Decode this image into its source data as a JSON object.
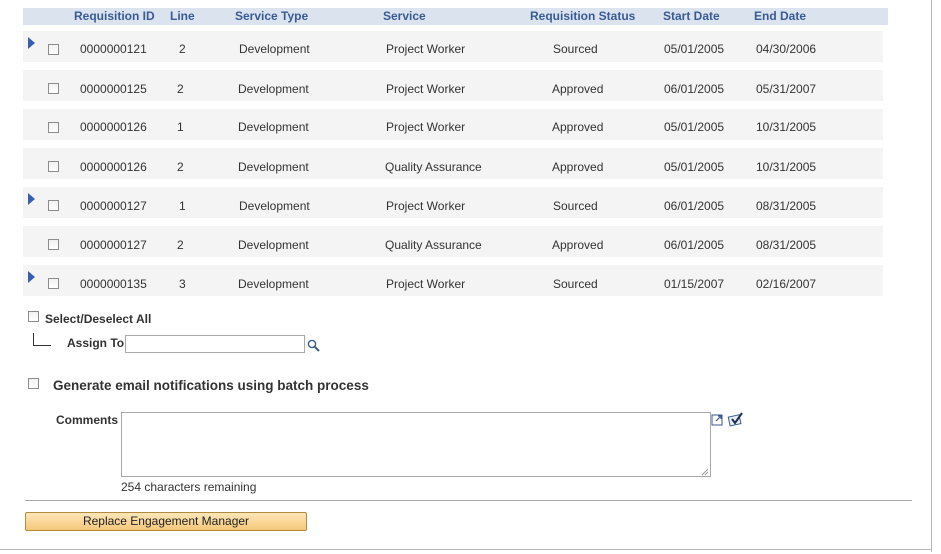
{
  "columns": {
    "requisition_id": "Requisition ID",
    "line": "Line",
    "service_type": "Service Type",
    "service": "Service",
    "requisition_status": "Requisition Status",
    "start_date": "Start Date",
    "end_date": "End Date"
  },
  "rows": [
    {
      "requisition_id": "0000000121",
      "line": "2",
      "service_type": "Development",
      "service": "Project Worker",
      "status": "Sourced",
      "start_date": "05/01/2005",
      "end_date": "04/30/2006",
      "expandable": true
    },
    {
      "requisition_id": "0000000125",
      "line": "2",
      "service_type": "Development",
      "service": "Project Worker",
      "status": "Approved",
      "start_date": "06/01/2005",
      "end_date": "05/31/2007",
      "expandable": false
    },
    {
      "requisition_id": "0000000126",
      "line": "1",
      "service_type": "Development",
      "service": "Project Worker",
      "status": "Approved",
      "start_date": "05/01/2005",
      "end_date": "10/31/2005",
      "expandable": false
    },
    {
      "requisition_id": "0000000126",
      "line": "2",
      "service_type": "Development",
      "service": "Quality Assurance",
      "status": "Approved",
      "start_date": "05/01/2005",
      "end_date": "10/31/2005",
      "expandable": false
    },
    {
      "requisition_id": "0000000127",
      "line": "1",
      "service_type": "Development",
      "service": "Project Worker",
      "status": "Sourced",
      "start_date": "06/01/2005",
      "end_date": "08/31/2005",
      "expandable": true
    },
    {
      "requisition_id": "0000000127",
      "line": "2",
      "service_type": "Development",
      "service": "Quality Assurance",
      "status": "Approved",
      "start_date": "06/01/2005",
      "end_date": "08/31/2005",
      "expandable": false
    },
    {
      "requisition_id": "0000000135",
      "line": "3",
      "service_type": "Development",
      "service": "Project Worker",
      "status": "Sourced",
      "start_date": "01/15/2007",
      "end_date": "02/16/2007",
      "expandable": true
    }
  ],
  "select_all_label": "Select/Deselect All",
  "assign_to_label": "Assign To",
  "assign_to_value": "",
  "email_notification_label": "Generate email notifications using batch process",
  "comments_label": "Comments",
  "comments_value": "",
  "chars_remaining": "254 characters remaining",
  "replace_button_label": "Replace Engagement Manager",
  "icons": {
    "expand_row": "triangle-right-icon",
    "lookup": "magnifier-icon",
    "expand_field": "expand-window-icon",
    "spell_check": "spell-check-icon"
  },
  "colors": {
    "header_bg": "#dbe4ee",
    "header_text": "#3a5a93",
    "row_bg": "#f4f4f4",
    "button_bg": "#f5c77a",
    "arrow": "#3b5fb0"
  }
}
